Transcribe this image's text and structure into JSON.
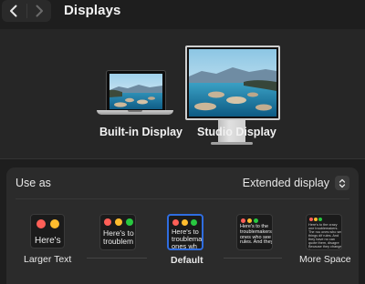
{
  "toolbar": {
    "title": "Displays",
    "back_icon": "chevron-left-icon",
    "forward_icon": "chevron-right-icon"
  },
  "displays": [
    {
      "name": "Built-in Display",
      "icon": "laptop-icon"
    },
    {
      "name": "Studio Display",
      "icon": "monitor-icon"
    }
  ],
  "settings": {
    "use_as_label": "Use as",
    "use_as_value": "Extended display",
    "popup_icon": "up-down-chevron-icon"
  },
  "resolution_options": [
    {
      "label": "Larger Text",
      "preview_text": "Here's"
    },
    {
      "label": "",
      "preview_text": "Here's to troublem"
    },
    {
      "label": "Default",
      "preview_text": "Here's to troublema ones wh",
      "selected": true
    },
    {
      "label": "",
      "preview_text": "Here's to the troublemakers. ones who see t rules. And they"
    },
    {
      "label": "More Space",
      "preview_text": "Here's to the crazy one troublemakers. The rou ones who see things dif rules. And they have no can quote them, disagre Because they change th"
    }
  ],
  "colors": {
    "accent": "#2f6de0",
    "traffic_red": "#ff5f57",
    "traffic_yellow": "#febc2e",
    "traffic_green": "#28c840"
  }
}
